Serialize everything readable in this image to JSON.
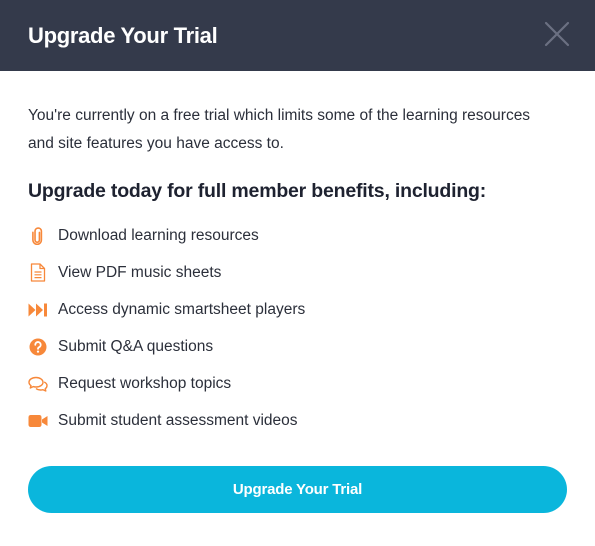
{
  "modal": {
    "title": "Upgrade Your Trial",
    "close_icon": "close-icon"
  },
  "intro": "You're currently on a free trial which limits some of the learning resources and site features you have access to.",
  "subhead": "Upgrade today for full member benefits, including:",
  "features": [
    {
      "icon": "paperclip-icon",
      "label": "Download learning resources"
    },
    {
      "icon": "document-icon",
      "label": "View PDF music sheets"
    },
    {
      "icon": "fast-forward-icon",
      "label": "Access dynamic smartsheet players"
    },
    {
      "icon": "question-circle-icon",
      "label": "Submit Q&A questions"
    },
    {
      "icon": "chat-bubbles-icon",
      "label": "Request workshop topics"
    },
    {
      "icon": "video-camera-icon",
      "label": "Submit student assessment videos"
    }
  ],
  "cta_label": "Upgrade Your Trial",
  "colors": {
    "header_bg": "#343a4b",
    "accent": "#f7883a",
    "button": "#0ab6dc"
  }
}
